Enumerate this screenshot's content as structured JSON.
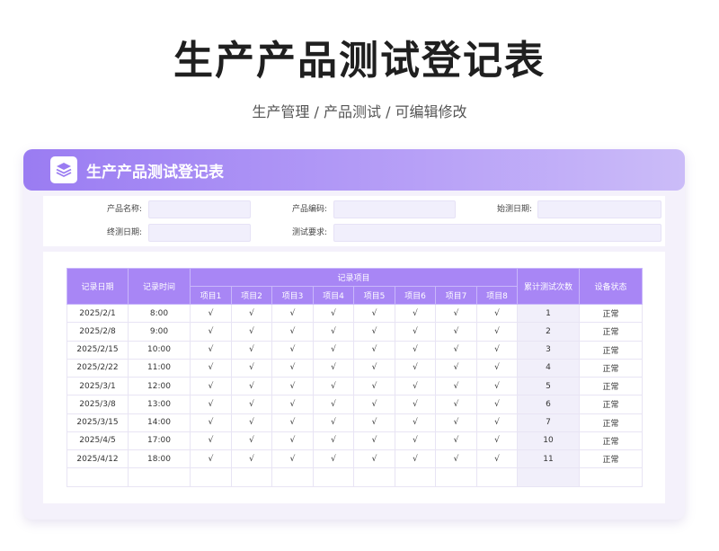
{
  "page": {
    "title": "生产产品测试登记表",
    "subtitle": "生产管理 / 产品测试 /  可编辑修改"
  },
  "card": {
    "title": "生产产品测试登记表",
    "icon": "layers-icon"
  },
  "info": {
    "product_name_label": "产品名称:",
    "product_name_value": "",
    "product_code_label": "产品编码:",
    "product_code_value": "",
    "start_date_label": "始测日期:",
    "start_date_value": "",
    "end_date_label": "终测日期:",
    "end_date_value": "",
    "requirement_label": "测试要求:",
    "requirement_value": ""
  },
  "table": {
    "headers": {
      "date": "记录日期",
      "time": "记录时间",
      "items_group": "记录项目",
      "items": [
        "项目1",
        "项目2",
        "项目3",
        "项目4",
        "项目5",
        "项目6",
        "项目7",
        "项目8"
      ],
      "count": "累计测试次数",
      "status": "设备状态"
    },
    "rows": [
      {
        "date": "2025/2/1",
        "time": "8:00",
        "checks": [
          "√",
          "√",
          "√",
          "√",
          "√",
          "√",
          "√",
          "√"
        ],
        "count": "1",
        "status": "正常"
      },
      {
        "date": "2025/2/8",
        "time": "9:00",
        "checks": [
          "√",
          "√",
          "√",
          "√",
          "√",
          "√",
          "√",
          "√"
        ],
        "count": "2",
        "status": "正常"
      },
      {
        "date": "2025/2/15",
        "time": "10:00",
        "checks": [
          "√",
          "√",
          "√",
          "√",
          "√",
          "√",
          "√",
          "√"
        ],
        "count": "3",
        "status": "正常"
      },
      {
        "date": "2025/2/22",
        "time": "11:00",
        "checks": [
          "√",
          "√",
          "√",
          "√",
          "√",
          "√",
          "√",
          "√"
        ],
        "count": "4",
        "status": "正常"
      },
      {
        "date": "2025/3/1",
        "time": "12:00",
        "checks": [
          "√",
          "√",
          "√",
          "√",
          "√",
          "√",
          "√",
          "√"
        ],
        "count": "5",
        "status": "正常"
      },
      {
        "date": "2025/3/8",
        "time": "13:00",
        "checks": [
          "√",
          "√",
          "√",
          "√",
          "√",
          "√",
          "√",
          "√"
        ],
        "count": "6",
        "status": "正常"
      },
      {
        "date": "2025/3/15",
        "time": "14:00",
        "checks": [
          "√",
          "√",
          "√",
          "√",
          "√",
          "√",
          "√",
          "√"
        ],
        "count": "7",
        "status": "正常"
      },
      {
        "date": "2025/4/5",
        "time": "17:00",
        "checks": [
          "√",
          "√",
          "√",
          "√",
          "√",
          "√",
          "√",
          "√"
        ],
        "count": "10",
        "status": "正常"
      },
      {
        "date": "2025/4/12",
        "time": "18:00",
        "checks": [
          "√",
          "√",
          "√",
          "√",
          "√",
          "√",
          "√",
          "√"
        ],
        "count": "11",
        "status": "正常"
      },
      {
        "date": "",
        "time": "",
        "checks": [
          "",
          "",
          "",
          "",
          "",
          "",
          "",
          ""
        ],
        "count": "",
        "status": ""
      }
    ]
  }
}
